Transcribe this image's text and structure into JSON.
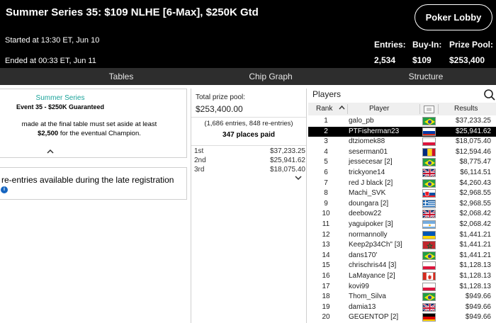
{
  "header": {
    "title": "Summer Series 35: $109 NLHE [6-Max], $250K Gtd",
    "started": "Started at 13:30 ET, Jun 10",
    "ended": "Ended at 00:33 ET, Jun 11",
    "lobby_button": "Poker Lobby",
    "entries_label": "Entries:",
    "entries_value": "2,534",
    "buyin_label": "Buy-In:",
    "buyin_value": "$109",
    "pool_label": "Prize Pool:",
    "pool_value": "$253,400"
  },
  "tabs": [
    "Tables",
    "Chip Graph",
    "Structure"
  ],
  "info_panel": {
    "series": "Summer Series",
    "event": "Event 35 - $250K Guaranteed",
    "line1": "made at the final table must set aside at least",
    "amount": "$2,500",
    "line2": "for the eventual Champion.",
    "reentry": "re-entries available during the late registration"
  },
  "prize": {
    "label": "Total prize pool:",
    "value": "$253,400.00",
    "entries": "(1,686 entries, 848 re-entries)",
    "paid": "347 places paid",
    "rows": [
      {
        "place": "1st",
        "amount": "$37,233.25"
      },
      {
        "place": "2nd",
        "amount": "$25,941.62"
      },
      {
        "place": "3rd",
        "amount": "$18,075.40"
      }
    ]
  },
  "players": {
    "title": "Players",
    "col_rank": "Rank",
    "col_player": "Player",
    "col_results": "Results",
    "rows": [
      {
        "rank": "1",
        "name": "galo_pb",
        "flag": "br",
        "result": "$37,233.25"
      },
      {
        "rank": "2",
        "name": "PTFisherman23",
        "flag": "ru",
        "result": "$25,941.62"
      },
      {
        "rank": "3",
        "name": "dtziomek88",
        "flag": "pl",
        "result": "$18,075.40"
      },
      {
        "rank": "4",
        "name": "seserman01",
        "flag": "ro",
        "result": "$12,594.46"
      },
      {
        "rank": "5",
        "name": "jessecesar [2]",
        "flag": "br",
        "result": "$8,775.47"
      },
      {
        "rank": "6",
        "name": "trickyone14",
        "flag": "gb",
        "result": "$6,114.51"
      },
      {
        "rank": "7",
        "name": "red J black [2]",
        "flag": "br",
        "result": "$4,260.43"
      },
      {
        "rank": "8",
        "name": "Machi_SVK",
        "flag": "sk",
        "result": "$2,968.55"
      },
      {
        "rank": "9",
        "name": "doungara [2]",
        "flag": "gr",
        "result": "$2,968.55"
      },
      {
        "rank": "10",
        "name": "deebow22",
        "flag": "gb",
        "result": "$2,068.42"
      },
      {
        "rank": "11",
        "name": "yaguipoker [3]",
        "flag": "ar",
        "result": "$2,068.42"
      },
      {
        "rank": "12",
        "name": "normannolly",
        "flag": "ua",
        "result": "$1,441.21"
      },
      {
        "rank": "13",
        "name": "Keep2p34Ch\" [3]",
        "flag": "ma",
        "result": "$1,441.21"
      },
      {
        "rank": "14",
        "name": "dans170'",
        "flag": "br",
        "result": "$1,441.21"
      },
      {
        "rank": "15",
        "name": "chrischris44 [3]",
        "flag": "pl",
        "result": "$1,128.13"
      },
      {
        "rank": "16",
        "name": "LaMayance [2]",
        "flag": "ca",
        "result": "$1,128.13"
      },
      {
        "rank": "17",
        "name": "kovi99",
        "flag": "pl",
        "result": "$1,128.13"
      },
      {
        "rank": "18",
        "name": "Thom_Silva",
        "flag": "br",
        "result": "$949.66"
      },
      {
        "rank": "19",
        "name": "damia13",
        "flag": "gb",
        "result": "$949.66"
      },
      {
        "rank": "20",
        "name": "GEGENTOP [2]",
        "flag": "de",
        "result": "$949.66"
      }
    ]
  },
  "colors": {
    "header_bg": "#000000",
    "tab_bar_bg": "#2d2d2d",
    "accent_teal": "#1aa39a",
    "info_blue": "#1565c0",
    "selected_row_bg": "#000000"
  }
}
